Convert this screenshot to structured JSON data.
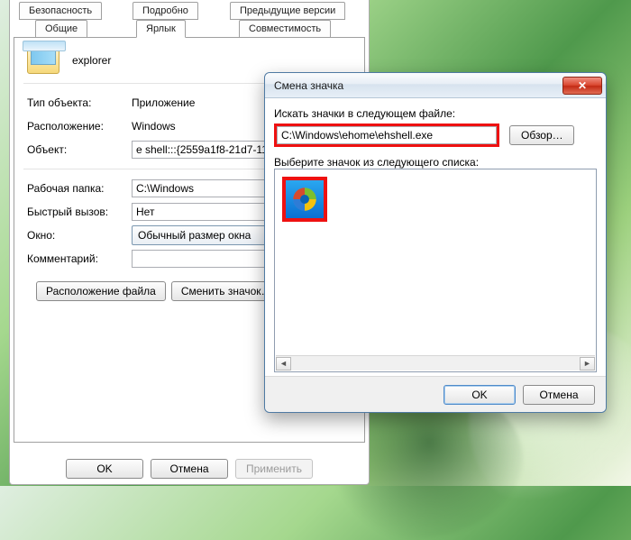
{
  "props": {
    "tabs": {
      "security": "Безопасность",
      "details": "Подробно",
      "previous": "Предыдущие версии",
      "general": "Общие",
      "shortcut": "Ярлык",
      "compat": "Совместимость"
    },
    "icon_name": "explorer",
    "rows": {
      "type_label": "Тип объекта:",
      "type_value": "Приложение",
      "location_label": "Расположение:",
      "location_value": "Windows",
      "object_label": "Объект:",
      "object_value": "e shell:::{2559a1f8-21d7-11d4",
      "workdir_label": "Рабочая папка:",
      "workdir_value": "C:\\Windows",
      "hotkey_label": "Быстрый вызов:",
      "hotkey_value": "Нет",
      "window_label": "Окно:",
      "window_value": "Обычный размер окна",
      "comment_label": "Комментарий:",
      "comment_value": ""
    },
    "buttons": {
      "open_location": "Расположение файла",
      "change_icon": "Сменить значок…"
    },
    "footer": {
      "ok": "OK",
      "cancel": "Отмена",
      "apply": "Применить"
    }
  },
  "dialog": {
    "title": "Смена значка",
    "search_label": "Искать значки в следующем файле:",
    "path_value": "C:\\Windows\\ehome\\ehshell.exe",
    "browse": "Обзор…",
    "pick_label": "Выберите значок из следующего списка:",
    "ok": "OK",
    "cancel": "Отмена",
    "icons": [
      "windows-media-center-icon"
    ]
  }
}
